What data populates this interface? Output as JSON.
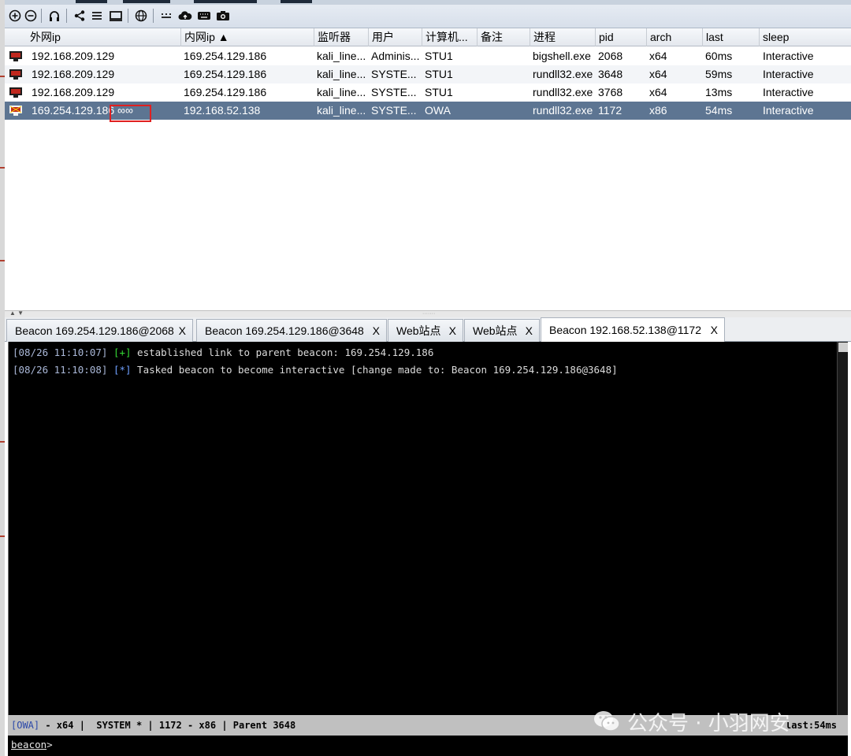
{
  "toolbar": {
    "buttons": [
      "add-circle-icon",
      "remove-circle-icon",
      "headphones-icon",
      "share-icon",
      "list-icon",
      "monitor-icon",
      "globe-icon",
      "ellipsis-icon",
      "cloud-upload-icon",
      "keyboard-icon",
      "camera-icon"
    ]
  },
  "table": {
    "columns": [
      "外网ip",
      "内网ip ▲",
      "监听器",
      "用户",
      "计算机...",
      "备注",
      "进程",
      "pid",
      "arch",
      "last",
      "sleep"
    ],
    "rows": [
      {
        "external": "192.168.209.129",
        "internal": "169.254.129.186",
        "listener": "kali_line...",
        "user": "Adminis...",
        "computer": "STU1",
        "note": "",
        "process": "bigshell.exe",
        "pid": "2068",
        "arch": "x64",
        "last": "60ms",
        "sleep": "Interactive"
      },
      {
        "external": "192.168.209.129",
        "internal": "169.254.129.186",
        "listener": "kali_line...",
        "user": "SYSTE...",
        "computer": "STU1",
        "note": "",
        "process": "rundll32.exe",
        "pid": "3648",
        "arch": "x64",
        "last": "59ms",
        "sleep": "Interactive"
      },
      {
        "external": "192.168.209.129",
        "internal": "169.254.129.186",
        "listener": "kali_line...",
        "user": "SYSTE...",
        "computer": "STU1",
        "note": "",
        "process": "rundll32.exe",
        "pid": "3768",
        "arch": "x64",
        "last": "13ms",
        "sleep": "Interactive"
      },
      {
        "external": "169.254.129.186 ∞∞",
        "internal": "192.168.52.138",
        "listener": "kali_line...",
        "user": "SYSTE...",
        "computer": "OWA",
        "note": "",
        "process": "rundll32.exe",
        "pid": "1172",
        "arch": "x86",
        "last": "54ms",
        "sleep": "Interactive"
      }
    ]
  },
  "tabs": [
    {
      "label": "Beacon 169.254.129.186@2068",
      "close": "X"
    },
    {
      "label": "Beacon 169.254.129.186@3648",
      "close": "X"
    },
    {
      "label": "Web站点",
      "close": "X"
    },
    {
      "label": "Web站点",
      "close": "X"
    },
    {
      "label": "Beacon 192.168.52.138@1172",
      "close": "X"
    }
  ],
  "console": {
    "lines": [
      {
        "ts": "[08/26 11:10:07]",
        "tag": "[+]",
        "text": " established link to parent beacon: 169.254.129.186"
      },
      {
        "ts": "[08/26 11:10:08]",
        "tag": "[*]",
        "text": " Tasked beacon to become interactive [change made to: Beacon 169.254.129.186@3648]"
      }
    ]
  },
  "status": {
    "host": "[OWA]",
    "info": " - x64 |  SYSTEM * | 1172 - x86 | Parent 3648",
    "last": "last:54ms"
  },
  "watermark": {
    "text": "公众号 · 小羽网安"
  },
  "cmd": {
    "prompt": "beacon",
    "caret": ">"
  },
  "colors": {
    "selected_row": "#5d7592",
    "console_bg": "#000000",
    "status_bg": "#c0c0c0",
    "ok": "#34d834",
    "info": "#6fa0ff"
  }
}
